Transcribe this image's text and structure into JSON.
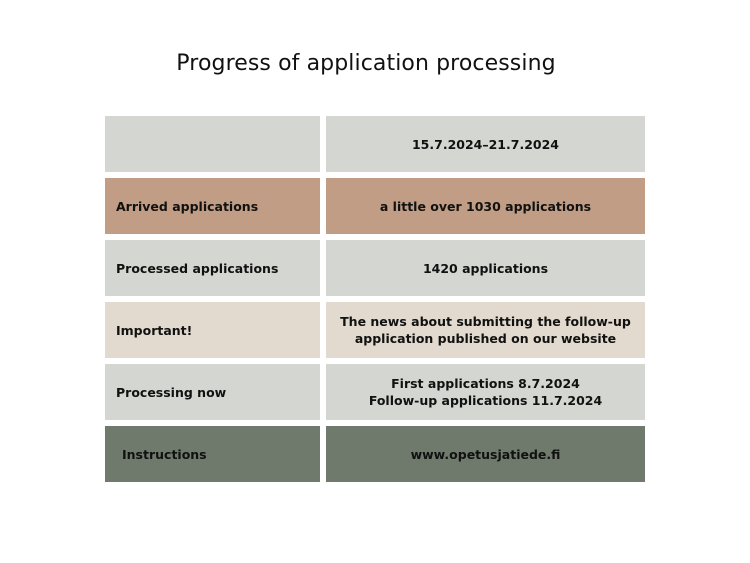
{
  "title": "Progress of application processing",
  "colors": {
    "gray": "#d4d6d1",
    "tan": "#c09d84",
    "beige": "#e2dace",
    "green": "#6f7a6d"
  },
  "table": {
    "header": {
      "label": "",
      "value": "15.7.2024–21.7.2024"
    },
    "rows": [
      {
        "label": "Arrived applications",
        "value": "a little over 1030 applications"
      },
      {
        "label": "Processed applications",
        "value": "1420 applications"
      },
      {
        "label": "Important!",
        "value_lines": [
          "The news about submitting the follow-up",
          "application published on our website"
        ]
      },
      {
        "label": "Processing now",
        "value_lines": [
          "First applications 8.7.2024",
          "Follow-up applications 11.7.2024"
        ]
      },
      {
        "label": "Instructions",
        "value": "www.opetusjatiede.fi"
      }
    ]
  }
}
